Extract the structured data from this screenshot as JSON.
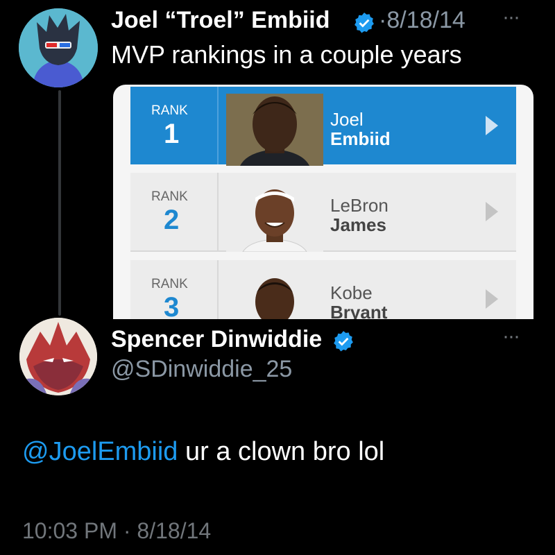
{
  "tweet1": {
    "display_name": "Joel “Troel” Embiid",
    "date_separator": "·",
    "date": "8/18/14",
    "more_label": "···",
    "text": "MVP rankings in a couple years",
    "card": {
      "rows": [
        {
          "rank_label": "RANK",
          "rank": "1",
          "first_name": "Joel",
          "last_name": "Embiid"
        },
        {
          "rank_label": "RANK",
          "rank": "2",
          "first_name": "LeBron",
          "last_name": "James"
        },
        {
          "rank_label": "RANK",
          "rank": "3",
          "first_name": "Kobe",
          "last_name": "Bryant"
        }
      ]
    }
  },
  "tweet2": {
    "display_name": "Spencer Dinwiddie",
    "handle": "@SDinwiddie_25",
    "more_label": "···",
    "mention": "@JoelEmbiid",
    "text": " ur a clown bro lol",
    "timestamp": "10:03 PM · 8/18/14"
  },
  "colors": {
    "background": "#000000",
    "verified": "#1d9bf0",
    "mention": "#1d9bf0",
    "secondary_text": "#71767b",
    "card_highlight": "#1e88d0"
  },
  "icons": {
    "verified": "verified-badge-icon",
    "more": "more-options-icon",
    "card_arrow": "chevron-right-icon"
  }
}
